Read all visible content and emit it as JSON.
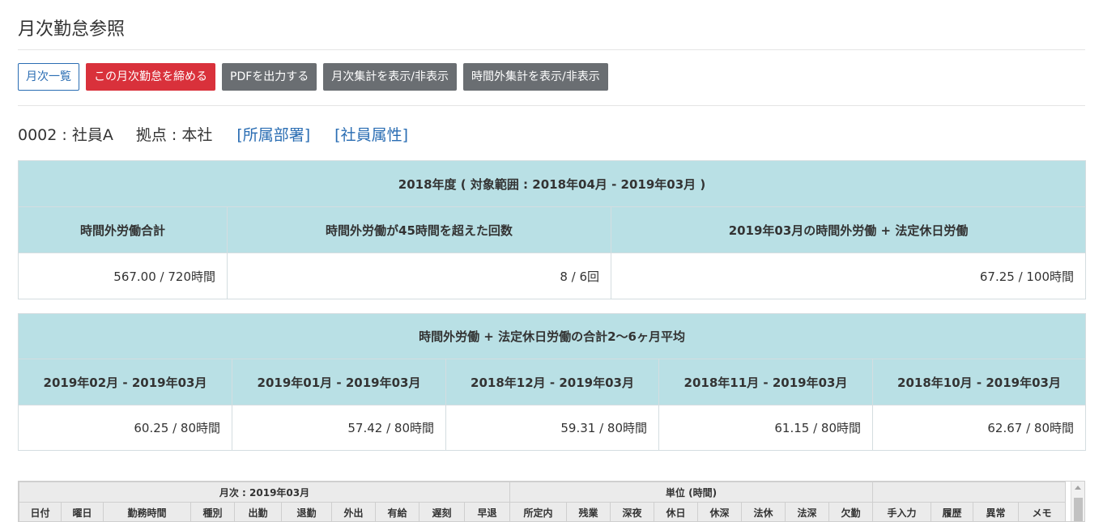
{
  "page": {
    "title": "月次勤怠参照"
  },
  "toolbar": {
    "monthly_list": "月次一覧",
    "close_month": "この月次勤怠を締める",
    "export_pdf": "PDFを出力する",
    "toggle_monthly_summary": "月次集計を表示/非表示",
    "toggle_overtime_summary": "時間外集計を表示/非表示"
  },
  "employee": {
    "id_name": "0002 : 社員A",
    "location": "拠点 : 本社",
    "dept_link": "[所属部署]",
    "attr_link": "[社員属性]"
  },
  "annual": {
    "header": "2018年度 ( 対象範囲 : 2018年04月 - 2019年03月 )",
    "columns": [
      "時間外労働合計",
      "時間外労働が45時間を超えた回数",
      "2019年03月の時間外労働 + 法定休日労働"
    ],
    "values": [
      "567.00 / 720時間",
      "8 / 6回",
      "67.25 / 100時間"
    ]
  },
  "average": {
    "header": "時間外労働 + 法定休日労働の合計2〜6ヶ月平均",
    "columns": [
      "2019年02月 - 2019年03月",
      "2019年01月 - 2019年03月",
      "2018年12月 - 2019年03月",
      "2018年11月 - 2019年03月",
      "2018年10月 - 2019年03月"
    ],
    "values": [
      "60.25 / 80時間",
      "57.42 / 80時間",
      "59.31 / 80時間",
      "61.15 / 80時間",
      "62.67 / 80時間"
    ]
  },
  "grid": {
    "group_monthly": "月次 : 2019年03月",
    "group_unit": "単位 (時間)",
    "group_extra": "",
    "columns": [
      "日付",
      "曜日",
      "勤務時間",
      "種別",
      "出勤",
      "退勤",
      "外出",
      "有給",
      "遅刻",
      "早退",
      "所定内",
      "残業",
      "深夜",
      "休日",
      "休深",
      "法休",
      "法深",
      "欠勤",
      "手入力",
      "履歴",
      "異常",
      "メモ"
    ]
  }
}
